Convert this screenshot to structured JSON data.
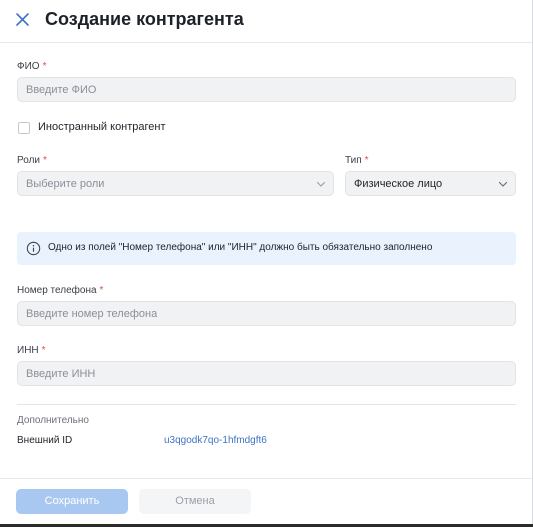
{
  "header": {
    "title": "Создание контрагента",
    "close_icon": "close-icon"
  },
  "form": {
    "fio": {
      "label": "ФИО",
      "required": "*",
      "placeholder": "Введите ФИО"
    },
    "foreign": {
      "label": "Иностранный контрагент",
      "checked": false
    },
    "roles": {
      "label": "Роли",
      "required": "*",
      "placeholder": "Выберите роли"
    },
    "type": {
      "label": "Тип",
      "required": "*",
      "value": "Физическое лицо"
    },
    "info_message": "Одно из полей \"Номер телефона\" или \"ИНН\" должно быть обязательно заполнено",
    "phone": {
      "label": "Номер телефона",
      "required": "*",
      "placeholder": "Введите номер телефона"
    },
    "inn": {
      "label": "ИНН",
      "required": "*",
      "placeholder": "Введите ИНН"
    }
  },
  "additional": {
    "title": "Дополнительно",
    "external_id_label": "Внешний ID",
    "external_id_value": "u3qgodk7qo-1hfmdgft6"
  },
  "footer": {
    "save_label": "Сохранить",
    "cancel_label": "Отмена"
  },
  "colors": {
    "accent": "#3f73c6",
    "required": "#e5484d",
    "info_bg": "#e9f2fd",
    "primary_disabled": "#a9c8f1"
  }
}
